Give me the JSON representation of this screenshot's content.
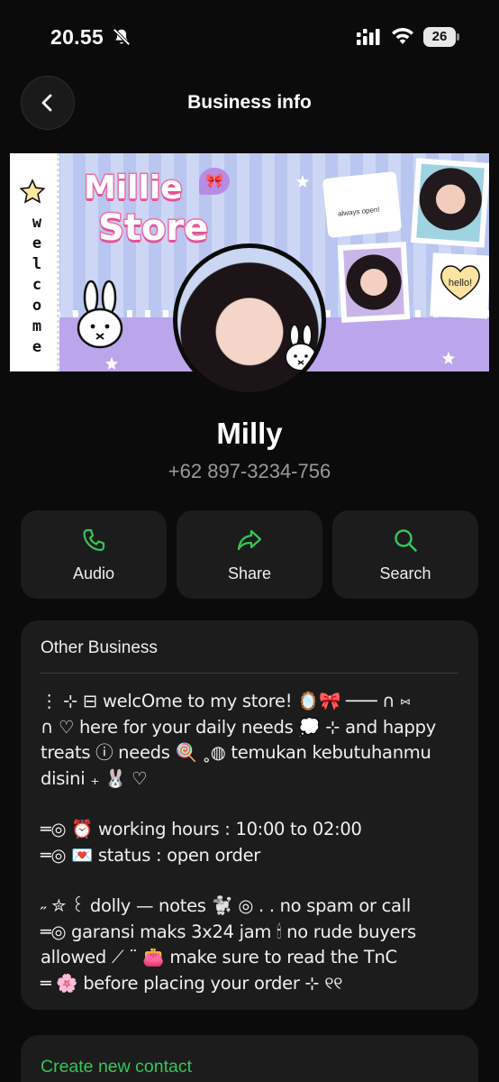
{
  "status_bar": {
    "time": "20.55",
    "battery": "26"
  },
  "header": {
    "title": "Business info"
  },
  "cover": {
    "store_name_line1": "Millie",
    "store_name_line2": "Store",
    "welcome_text": "welcome",
    "ticket_text": "always open!",
    "hello_text": "hello!"
  },
  "profile": {
    "name": "Milly",
    "phone": "+62 897-3234-756"
  },
  "actions": [
    {
      "label": "Audio",
      "icon": "phone-icon"
    },
    {
      "label": "Share",
      "icon": "share-arrow-icon"
    },
    {
      "label": "Search",
      "icon": "search-icon"
    }
  ],
  "business": {
    "category": "Other Business",
    "description_lines": [
      "⋮ ⊹ ⊟ welcOme to my store! 🪞🎀 ─── ∩ ⑅",
      "∩ ♡ here for your daily needs 💭 ⊹ and happy",
      "treats ⓘ needs 🍭 ˳◍ temukan kebutuhanmu",
      "disini ₊ 🐰 ♡",
      "",
      "═◎ ⏰ working hours :  10:00 to 02:00",
      "═◎ 💌 status          :  open order",
      "",
      "˶ ✮ ꒰ dolly — notes 🐩 ◎ . .  no spam or call",
      "═◎ garansi maks 3x24 jam 🕯 no rude buyers",
      "allowed ⟋  ¨ 👛 make sure to read the TnC",
      "═ 🌸 before placing your order ⊹ ୧୧"
    ]
  },
  "footer": {
    "create_contact": "Create new contact"
  },
  "colors": {
    "background": "#0b0b0b",
    "card": "#1c1c1c",
    "accent_green": "#34c759",
    "muted_text": "#9a9a9a"
  }
}
